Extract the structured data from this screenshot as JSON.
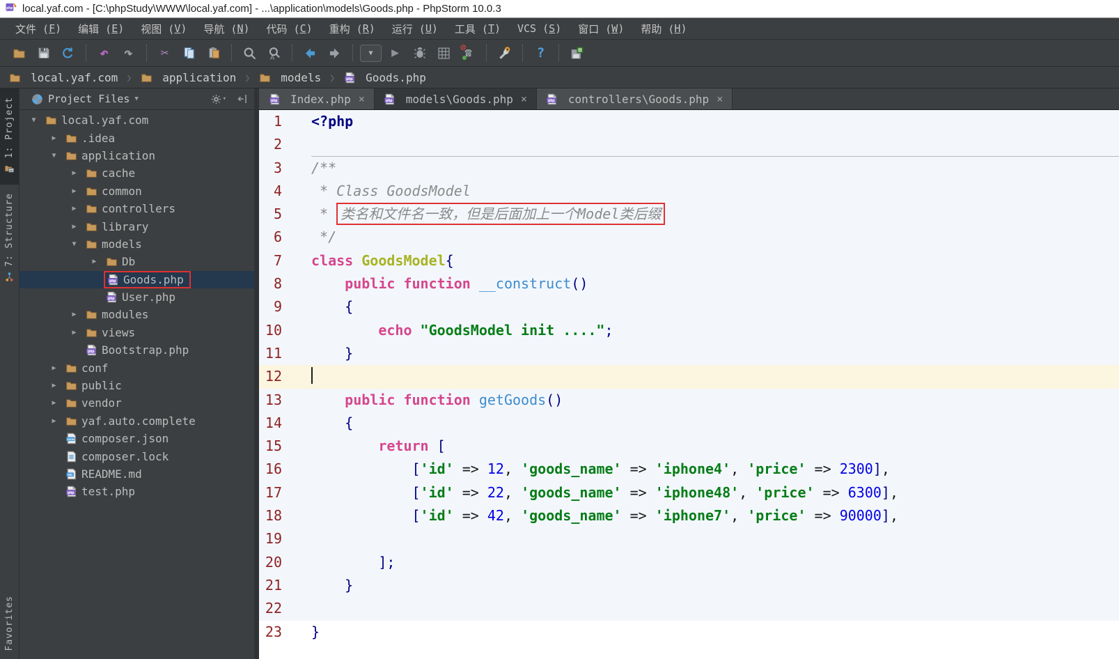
{
  "title_bar": {
    "app_icon": "phpstorm-logo",
    "title": "local.yaf.com - [C:\\phpStudy\\WWW\\local.yaf.com] - ...\\application\\models\\Goods.php - PhpStorm 10.0.3"
  },
  "menu_bar": {
    "items": [
      {
        "label": "文件",
        "mnemonic": "F"
      },
      {
        "label": "编辑",
        "mnemonic": "E"
      },
      {
        "label": "视图",
        "mnemonic": "V"
      },
      {
        "label": "导航",
        "mnemonic": "N"
      },
      {
        "label": "代码",
        "mnemonic": "C"
      },
      {
        "label": "重构",
        "mnemonic": "R"
      },
      {
        "label": "运行",
        "mnemonic": "U"
      },
      {
        "label": "工具",
        "mnemonic": "T"
      },
      {
        "label": "VCS",
        "mnemonic": "S"
      },
      {
        "label": "窗口",
        "mnemonic": "W"
      },
      {
        "label": "帮助",
        "mnemonic": "H"
      }
    ]
  },
  "toolbar": {
    "groups": [
      [
        "open-folder",
        "save-all",
        "synchronize"
      ],
      [
        "undo",
        "redo"
      ],
      [
        "cut",
        "copy",
        "paste"
      ],
      [
        "find",
        "replace"
      ],
      [
        "back",
        "forward"
      ],
      [
        "run-config-dropdown",
        "run",
        "debug",
        "coverage",
        "mute-breakpoints"
      ],
      [
        "settings"
      ],
      [
        "help"
      ],
      [
        "save-and-sync"
      ]
    ]
  },
  "breadcrumb_bar": {
    "items": [
      {
        "label": "local.yaf.com",
        "icon": "folder"
      },
      {
        "label": "application",
        "icon": "folder"
      },
      {
        "label": "models",
        "icon": "folder"
      },
      {
        "label": "Goods.php",
        "icon": "php-file"
      }
    ]
  },
  "tool_window_bar": {
    "top": [
      {
        "label": "1: Project",
        "icon": "project",
        "active": true
      },
      {
        "label": "7: Structure",
        "icon": "structure",
        "active": false
      }
    ],
    "bottom": [
      {
        "label": "Favorites",
        "icon": "favorites",
        "active": false
      }
    ]
  },
  "project_panel": {
    "header": {
      "title": "Project Files",
      "icons": [
        "views-pie",
        "settings-gear",
        "hide-panel"
      ]
    },
    "tree": [
      {
        "label": "local.yaf.com",
        "icon": "folder",
        "arrow": "down",
        "level": 0
      },
      {
        "label": ".idea",
        "icon": "folder",
        "arrow": "right",
        "level": 1
      },
      {
        "label": "application",
        "icon": "folder",
        "arrow": "down",
        "level": 1
      },
      {
        "label": "cache",
        "icon": "folder",
        "arrow": "right",
        "level": 2
      },
      {
        "label": "common",
        "icon": "folder",
        "arrow": "right",
        "level": 2
      },
      {
        "label": "controllers",
        "icon": "folder",
        "arrow": "right",
        "level": 2
      },
      {
        "label": "library",
        "icon": "folder",
        "arrow": "right",
        "level": 2
      },
      {
        "label": "models",
        "icon": "folder",
        "arrow": "down",
        "level": 2
      },
      {
        "label": "Db",
        "icon": "folder",
        "arrow": "right",
        "level": 3
      },
      {
        "label": "Goods.php",
        "icon": "php-file",
        "arrow": "none",
        "level": 3,
        "selected": true,
        "annotated": true
      },
      {
        "label": "User.php",
        "icon": "php-file",
        "arrow": "none",
        "level": 3
      },
      {
        "label": "modules",
        "icon": "folder",
        "arrow": "right",
        "level": 2
      },
      {
        "label": "views",
        "icon": "folder",
        "arrow": "right",
        "level": 2
      },
      {
        "label": "Bootstrap.php",
        "icon": "php-file",
        "arrow": "none",
        "level": 2
      },
      {
        "label": "conf",
        "icon": "folder",
        "arrow": "right",
        "level": 1
      },
      {
        "label": "public",
        "icon": "folder",
        "arrow": "right",
        "level": 1
      },
      {
        "label": "vendor",
        "icon": "folder",
        "arrow": "right",
        "level": 1
      },
      {
        "label": "yaf.auto.complete",
        "icon": "folder",
        "arrow": "right",
        "level": 1
      },
      {
        "label": "composer.json",
        "icon": "json-file",
        "arrow": "none",
        "level": 1
      },
      {
        "label": "composer.lock",
        "icon": "lock-file",
        "arrow": "none",
        "level": 1
      },
      {
        "label": "README.md",
        "icon": "md-file",
        "arrow": "none",
        "level": 1
      },
      {
        "label": "test.php",
        "icon": "php-file",
        "arrow": "none",
        "level": 1
      }
    ]
  },
  "editor": {
    "tabs": [
      {
        "label": "Index.php",
        "icon": "php-file",
        "active": false
      },
      {
        "label": "models\\Goods.php",
        "icon": "php-file",
        "active": true
      },
      {
        "label": "controllers\\Goods.php",
        "icon": "php-file",
        "active": false
      }
    ],
    "current_line": 12,
    "colors": {
      "keyword": "#d6458c",
      "class_name": "#a8b324",
      "function_name": "#3f8ccc",
      "string": "#067d17",
      "number": "#0000e6",
      "punctuation": "#000080",
      "comment": "#8a8a8a",
      "line_number": "#8f2222",
      "current_line_bg": "#fcf5df",
      "editor_tint": "#f3f7fc",
      "annotation_box": "#e03131"
    },
    "lines": [
      {
        "tokens": [
          [
            "php",
            "<?php"
          ]
        ]
      },
      {
        "tokens": [],
        "sep": true
      },
      {
        "tokens": [
          [
            "cmt",
            "/**"
          ]
        ]
      },
      {
        "tokens": [
          [
            "cmt",
            " * Class GoodsModel"
          ]
        ]
      },
      {
        "tokens": [
          [
            "cmt",
            " * "
          ],
          [
            "cmt",
            "类名和文件名一致，但是后面加上一个Model类后缀",
            "box"
          ]
        ]
      },
      {
        "tokens": [
          [
            "cmt",
            " */"
          ]
        ]
      },
      {
        "tokens": [
          [
            "kw",
            "class "
          ],
          [
            "cls",
            "GoodsModel"
          ],
          [
            "pun",
            "{"
          ]
        ]
      },
      {
        "tokens": [
          [
            "pl",
            "    "
          ],
          [
            "kw",
            "public function "
          ],
          [
            "fn",
            "__construct"
          ],
          [
            "pun",
            "()"
          ]
        ]
      },
      {
        "tokens": [
          [
            "pl",
            "    "
          ],
          [
            "pun",
            "{"
          ]
        ]
      },
      {
        "tokens": [
          [
            "pl",
            "        "
          ],
          [
            "kw",
            "echo "
          ],
          [
            "str",
            "\"GoodsModel init ....\""
          ],
          [
            "pun",
            ";"
          ]
        ]
      },
      {
        "tokens": [
          [
            "pl",
            "    "
          ],
          [
            "pun",
            "}"
          ]
        ]
      },
      {
        "tokens": [],
        "current": true
      },
      {
        "tokens": [
          [
            "pl",
            "    "
          ],
          [
            "kw",
            "public function "
          ],
          [
            "fn",
            "getGoods"
          ],
          [
            "pun",
            "()"
          ]
        ]
      },
      {
        "tokens": [
          [
            "pl",
            "    "
          ],
          [
            "pun",
            "{"
          ]
        ]
      },
      {
        "tokens": [
          [
            "pl",
            "        "
          ],
          [
            "kw",
            "return "
          ],
          [
            "pun",
            "["
          ]
        ]
      },
      {
        "tokens": [
          [
            "pl",
            "            "
          ],
          [
            "pun",
            "["
          ],
          [
            "str",
            "'id'"
          ],
          [
            "pl",
            " => "
          ],
          [
            "num",
            "12"
          ],
          [
            "pl",
            ", "
          ],
          [
            "str",
            "'goods_name'"
          ],
          [
            "pl",
            " => "
          ],
          [
            "str",
            "'iphone4'"
          ],
          [
            "pl",
            ", "
          ],
          [
            "str",
            "'price'"
          ],
          [
            "pl",
            " => "
          ],
          [
            "num",
            "2300"
          ],
          [
            "pun",
            "]"
          ],
          [
            "pl",
            ","
          ]
        ]
      },
      {
        "tokens": [
          [
            "pl",
            "            "
          ],
          [
            "pun",
            "["
          ],
          [
            "str",
            "'id'"
          ],
          [
            "pl",
            " => "
          ],
          [
            "num",
            "22"
          ],
          [
            "pl",
            ", "
          ],
          [
            "str",
            "'goods_name'"
          ],
          [
            "pl",
            " => "
          ],
          [
            "str",
            "'iphone48'"
          ],
          [
            "pl",
            ", "
          ],
          [
            "str",
            "'price'"
          ],
          [
            "pl",
            " => "
          ],
          [
            "num",
            "6300"
          ],
          [
            "pun",
            "]"
          ],
          [
            "pl",
            ","
          ]
        ]
      },
      {
        "tokens": [
          [
            "pl",
            "            "
          ],
          [
            "pun",
            "["
          ],
          [
            "str",
            "'id'"
          ],
          [
            "pl",
            " => "
          ],
          [
            "num",
            "42"
          ],
          [
            "pl",
            ", "
          ],
          [
            "str",
            "'goods_name'"
          ],
          [
            "pl",
            " => "
          ],
          [
            "str",
            "'iphone7'"
          ],
          [
            "pl",
            ", "
          ],
          [
            "str",
            "'price'"
          ],
          [
            "pl",
            " => "
          ],
          [
            "num",
            "90000"
          ],
          [
            "pun",
            "]"
          ],
          [
            "pl",
            ","
          ]
        ]
      },
      {
        "tokens": []
      },
      {
        "tokens": [
          [
            "pl",
            "        "
          ],
          [
            "pun",
            "];"
          ]
        ]
      },
      {
        "tokens": [
          [
            "pl",
            "    "
          ],
          [
            "pun",
            "}"
          ]
        ]
      },
      {
        "tokens": []
      },
      {
        "tokens": [
          [
            "pun",
            "}"
          ]
        ],
        "plain_bg": true
      }
    ]
  }
}
